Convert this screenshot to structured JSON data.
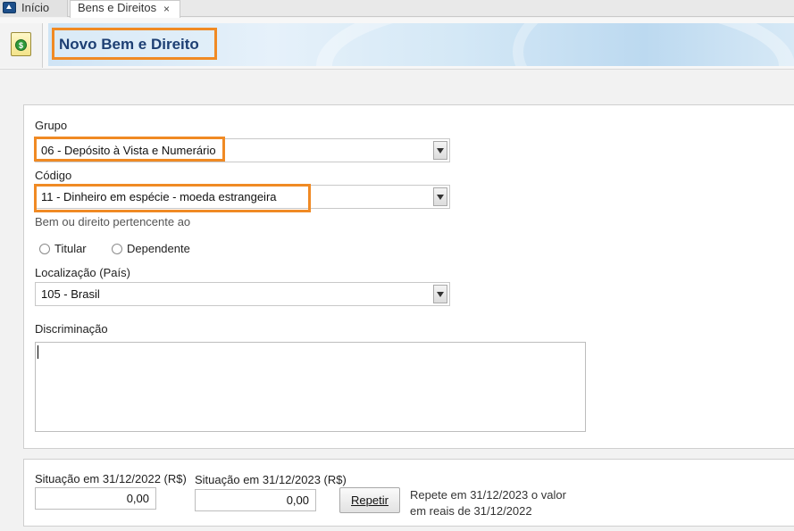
{
  "tabs": [
    {
      "label": "Início",
      "active": false
    },
    {
      "label": "Bens e Direitos",
      "active": true
    }
  ],
  "header": {
    "title": "Novo Bem e Direito",
    "icon": "money-document-icon"
  },
  "form": {
    "grupo": {
      "label": "Grupo",
      "value": "06 - Depósito à Vista e Numerário"
    },
    "codigo": {
      "label": "Código",
      "value": "11 - Dinheiro em espécie - moeda estrangeira"
    },
    "pertencente": {
      "label": "Bem ou direito pertencente ao",
      "options": [
        "Titular",
        "Dependente"
      ]
    },
    "localizacao": {
      "label": "Localização (País)",
      "value": "105 - Brasil"
    },
    "discriminacao": {
      "label": "Discriminação",
      "value": ""
    }
  },
  "valores": {
    "situacao_2022": {
      "label": "Situação em 31/12/2022 (R$)",
      "value": "0,00"
    },
    "situacao_2023": {
      "label": "Situação em 31/12/2023 (R$)",
      "value": "0,00"
    },
    "repetir_label": "Repetir",
    "hint_line1": "Repete em 31/12/2023 o valor",
    "hint_line2": "em reais de 31/12/2022"
  },
  "colors": {
    "highlight": "#f08a24",
    "title": "#1d3f73"
  }
}
